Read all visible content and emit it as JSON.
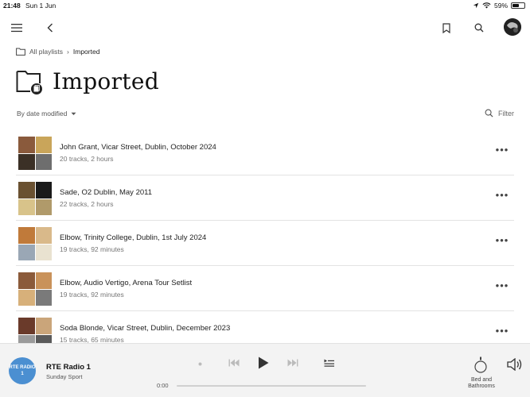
{
  "status": {
    "time": "21:48",
    "date": "Sun 1 Jun",
    "battery": "59%",
    "battery_level": 0.59
  },
  "breadcrumb": {
    "parent": "All playlists",
    "current": "Imported"
  },
  "page": {
    "title": "Imported"
  },
  "sort": {
    "label": "By date modified"
  },
  "filter": {
    "label": "Filter"
  },
  "playlists": [
    {
      "name": "John Grant, Vicar Street, Dublin, October 2024",
      "meta": "20 tracks, 2 hours",
      "colors": [
        "#8a5a3c",
        "#c9a55a",
        "#3b3026",
        "#6e6e6e"
      ]
    },
    {
      "name": "Sade, O2 Dublin, May 2011",
      "meta": "22 tracks, 2 hours",
      "colors": [
        "#6a5131",
        "#1a1a1a",
        "#d8c38a",
        "#b09a6a"
      ]
    },
    {
      "name": "Elbow, Trinity College, Dublin, 1st July 2024",
      "meta": "19 tracks, 92 minutes",
      "colors": [
        "#c07a3a",
        "#d9b98a",
        "#9aa7b5",
        "#e9e2d0"
      ]
    },
    {
      "name": "Elbow, Audio Vertigo, Arena Tour Setlist",
      "meta": "19 tracks, 92 minutes",
      "colors": [
        "#8b5a3a",
        "#c9925a",
        "#d7b07a",
        "#7a7a7a"
      ]
    },
    {
      "name": "Soda Blonde, Vicar Street, Dublin, December 2023",
      "meta": "15 tracks, 65 minutes",
      "colors": [
        "#6a3a2a",
        "#caa57a",
        "#9a9a9a",
        "#5a5a5a"
      ]
    }
  ],
  "player": {
    "logo_text": "RTE RADIO 1",
    "station": "RTE Radio 1",
    "program": "Sunday Sport",
    "elapsed": "0:00",
    "zone": "Bed and Bathrooms"
  },
  "icons": {
    "menu": "hamburger-icon",
    "back": "chevron-left-icon",
    "bookmark": "bookmark-icon",
    "search": "search-icon",
    "more": "more-horizontal-icon",
    "play": "play-icon",
    "prev": "skip-back-icon",
    "next": "skip-forward-icon",
    "queue": "queue-icon",
    "speaker": "speaker-icon",
    "volume": "volume-icon"
  }
}
